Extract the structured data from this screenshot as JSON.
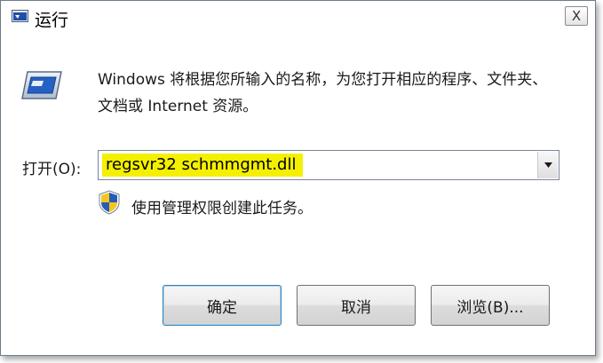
{
  "window": {
    "title": "运行",
    "close_glyph": "X"
  },
  "dialog": {
    "description": "Windows 将根据您所输入的名称，为您打开相应的程序、文件夹、文档或 Internet 资源。",
    "open_label": "打开(O):",
    "command_value": "regsvr32 schmmgmt.dll",
    "admin_note": "使用管理权限创建此任务。"
  },
  "buttons": {
    "ok": "确定",
    "cancel": "取消",
    "browse": "浏览(B)..."
  },
  "colors": {
    "highlight": "#f4f000",
    "default_button_border": "#3c7fb1",
    "shield_blue": "#2a5ab8",
    "shield_yellow": "#f2c81a"
  }
}
